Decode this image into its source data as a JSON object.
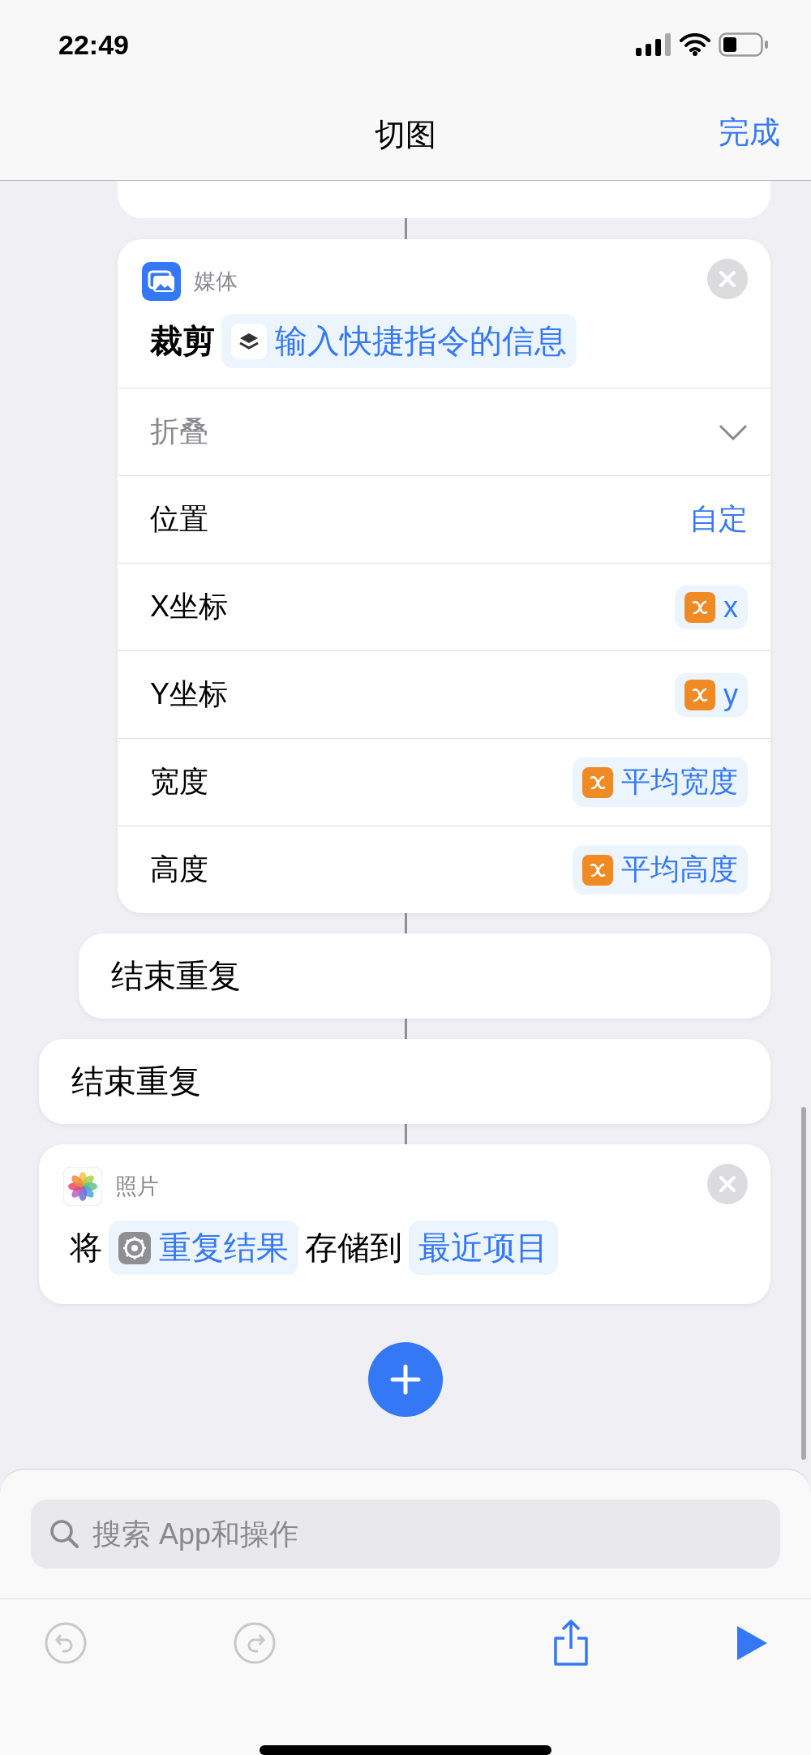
{
  "status_bar": {
    "time": "22:49"
  },
  "nav": {
    "title": "切图",
    "done": "完成"
  },
  "crop_action": {
    "app": "媒体",
    "verb": "裁剪",
    "input": "输入快捷指令的信息",
    "collapse": "折叠",
    "params": [
      {
        "label": "位置",
        "kind": "text",
        "value": "自定"
      },
      {
        "label": "X坐标",
        "kind": "variable",
        "value": "x"
      },
      {
        "label": "Y坐标",
        "kind": "variable",
        "value": "y"
      },
      {
        "label": "宽度",
        "kind": "variable",
        "value": "平均宽度"
      },
      {
        "label": "高度",
        "kind": "variable",
        "value": "平均高度"
      }
    ]
  },
  "end_repeats": [
    {
      "label": "结束重复"
    },
    {
      "label": "结束重复"
    }
  ],
  "save_action": {
    "app": "照片",
    "segments": [
      {
        "kind": "text",
        "text": "将"
      },
      {
        "kind": "result",
        "text": "重复结果"
      },
      {
        "kind": "text",
        "text": "存储到"
      },
      {
        "kind": "param",
        "text": "最近项目"
      }
    ]
  },
  "search": {
    "placeholder": "搜索 App和操作"
  },
  "toolbar": [
    {
      "kind": "undo",
      "disabled": true
    },
    {
      "kind": "redo",
      "disabled": true
    },
    {
      "kind": "share",
      "disabled": false
    },
    {
      "kind": "run",
      "disabled": false
    }
  ]
}
